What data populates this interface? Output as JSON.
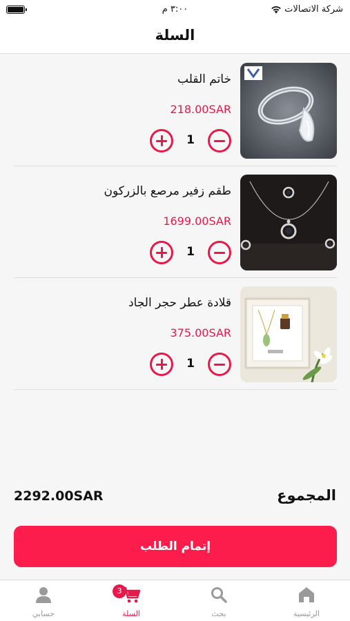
{
  "status_bar": {
    "carrier": "شركة الاتصالات",
    "time": "٣:٠٠ م"
  },
  "header": {
    "title": "السلة"
  },
  "cart": {
    "items": [
      {
        "name": "خاتم القلب",
        "price": "218.00SAR",
        "quantity": "1",
        "image": "silver-heart-ring-photo"
      },
      {
        "name": "طقم زفير مرصع بالزركون",
        "price": "1699.00SAR",
        "quantity": "1",
        "image": "zircon-necklace-earrings-set-photo"
      },
      {
        "name": "قلادة عطر حجر الجاد",
        "price": "375.00SAR",
        "quantity": "1",
        "image": "jade-perfume-pendant-gift-box-photo"
      }
    ]
  },
  "summary": {
    "total_label": "المجموع",
    "total_value": "2292.00SAR"
  },
  "checkout": {
    "label": "إتمام الطلب"
  },
  "tabs": {
    "home": {
      "label": "الرئيسية",
      "icon": "home-icon"
    },
    "search": {
      "label": "بحث",
      "icon": "search-icon"
    },
    "cart": {
      "label": "السلة",
      "icon": "cart-icon",
      "badge": "3"
    },
    "account": {
      "label": "حسابي",
      "icon": "user-icon"
    }
  },
  "colors": {
    "accent": "#e8184a",
    "button": "#fc1d4c",
    "inactive_tab": "#9a9a9a"
  }
}
